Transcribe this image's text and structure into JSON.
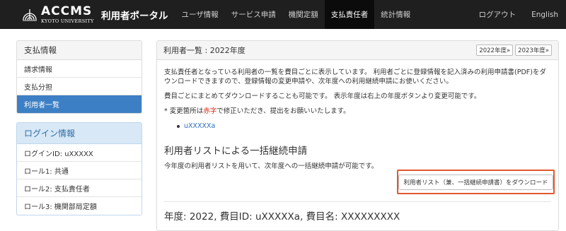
{
  "brand": {
    "name": "ACCMS",
    "sub": "KYOTO UNIVERSITY",
    "portal": "利用者ポータル"
  },
  "nav": {
    "items": [
      {
        "label": "ユーザ情報",
        "active": false
      },
      {
        "label": "サービス申請",
        "active": false
      },
      {
        "label": "機関定額",
        "active": false
      },
      {
        "label": "支払責任者",
        "active": true
      },
      {
        "label": "統計情報",
        "active": false
      }
    ],
    "logout": "ログアウト",
    "language": "English"
  },
  "sidebar": {
    "payment": {
      "title": "支払情報",
      "items": [
        {
          "label": "請求情報",
          "active": false
        },
        {
          "label": "支払分担",
          "active": false
        },
        {
          "label": "利用者一覧",
          "active": true
        }
      ]
    },
    "login": {
      "title": "ログイン情報",
      "items": [
        {
          "label": "ログインID: uXXXXX"
        },
        {
          "label": "ロール1: 共通"
        },
        {
          "label": "ロール2: 支払責任者"
        },
        {
          "label": "ロール3: 機関部局定額"
        }
      ]
    }
  },
  "main": {
    "title": "利用者一覧 : 2022年度",
    "year_buttons": [
      "2022年度»",
      "2023年度»"
    ],
    "para1": "支払責任者となっている利用者の一覧を費目ごとに表示しています。 利用者ごとに登録情報を記入済みの利用申請書(PDF)をダウンロードできますので、登録情報の変更申請や、次年度への利用継続申請にお使いください。",
    "para2": "費目ごとにまとめてダウンロードすることも可能です。 表示年度は右上の年度ボタンより変更可能です。",
    "note_prefix": "* 変更箇所は",
    "note_red": "赤字",
    "note_suffix": "で修正いただき、提出をお願いいたします。",
    "user_link": "uXXXXXa",
    "bulk_title": "利用者リストによる一括継続申請",
    "bulk_desc": "今年度の利用者リストを用いて、次年度への一括継続申請が可能です。",
    "download_button": "利用者リスト（兼、一括継続申請書）をダウンロード",
    "year_info": "年度: 2022, 費目ID: uXXXXXa, 費目名: XXXXXXXXX"
  },
  "colors": {
    "nav_bg": "#1f1f1f",
    "active_blue": "#3d7fc4",
    "link": "#2a6ebb",
    "highlight": "#e4572e",
    "red_text": "#d9230f"
  }
}
